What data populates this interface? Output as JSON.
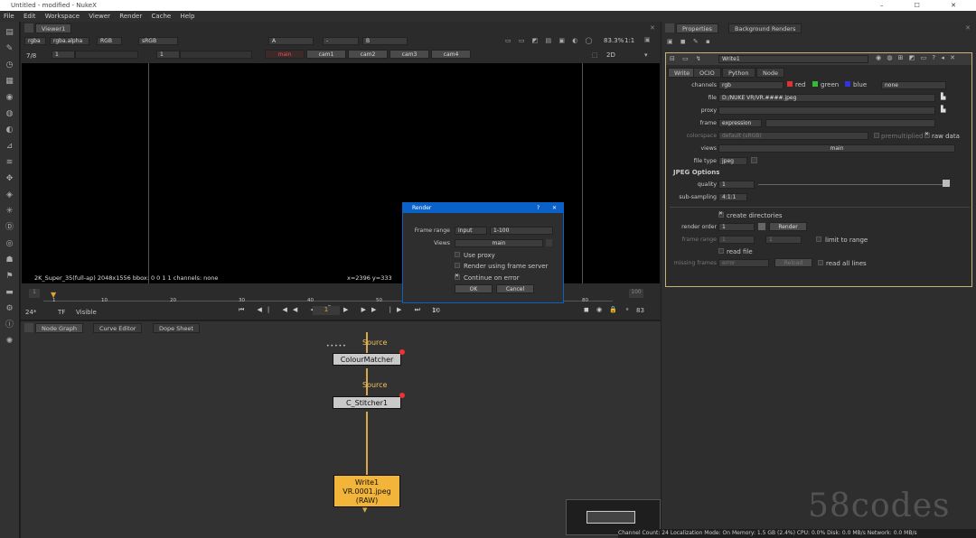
{
  "window": {
    "title": "Untitled - modified - NukeX",
    "controls": "– ☐ ✕"
  },
  "menu": [
    "File",
    "Edit",
    "Workspace",
    "Viewer",
    "Render",
    "Cache",
    "Help"
  ],
  "viewer": {
    "tab": "Viewer1",
    "channels": "rgba",
    "alpha": "rgba.alpha",
    "colorspace": "RGB",
    "lut": "sRGB",
    "input_a": "A",
    "input_b": "B",
    "zoom": "83.3%",
    "ratio": "1:1",
    "frame_fraction": "7/8",
    "frame_start": "1",
    "frame_num": "1",
    "view_mode": "2D",
    "view_buttons": [
      "main",
      "cam1",
      "cam2",
      "cam3",
      "cam4"
    ],
    "info_left": "2K_Super_35(full-ap) 2048x1556  bbox: 0 0 1 1 channels: none",
    "info_right": "x=2396 y=333"
  },
  "timeline": {
    "fps": "24*",
    "tf": "TF",
    "visible": "Visible",
    "current_frame": "1",
    "step": "10",
    "end_frame": "83",
    "ticks": [
      "1",
      "10",
      "20",
      "30",
      "40",
      "50",
      "60",
      "70",
      "80"
    ],
    "range_start": "1",
    "range_end": "100"
  },
  "graph_tabs": [
    "Node Graph",
    "Curve Editor",
    "Dope Sheet"
  ],
  "nodes": {
    "colour_matcher": "ColourMatcher",
    "stitcher": "C_Stitcher1",
    "source1": "Source",
    "source2": "Source",
    "write_line1": "Write1",
    "write_line2": "VR.0001.jpeg",
    "write_line3": "(RAW)"
  },
  "status_bar": "Channel Count: 24  Localization Mode: On  Memory: 1.5 GB (2.4%)  CPU: 0.0%  Disk: 0.0 MB/s  Network: 0.0 MB/s",
  "properties": {
    "tabs": [
      "Properties",
      "Background Renders"
    ],
    "node_name": "Write1",
    "subtabs": [
      "Write",
      "OCIO",
      "Python",
      "Node"
    ],
    "channels_label": "channels",
    "channels_value": "rgb",
    "chan_red": "red",
    "chan_green": "green",
    "chan_blue": "blue",
    "chan_none": "none",
    "file_label": "file",
    "file_value": "D:/NUKE VR/VR.####.jpeg",
    "proxy_label": "proxy",
    "frame_label": "frame",
    "frame_value": "expression",
    "colorspace_label": "colorspace",
    "colorspace_value": "default (sRGB)",
    "premultiplied": "premultiplied",
    "raw_data": "raw data",
    "views_label": "views",
    "views_value": "main",
    "filetype_label": "file type",
    "filetype_value": "jpeg",
    "jpeg_header": "JPEG Options",
    "quality_label": "quality",
    "quality_value": "1",
    "subsampling_label": "sub-sampling",
    "subsampling_value": "4:1:1",
    "create_dirs": "create directories",
    "render_order_label": "render order",
    "render_order_value": "1",
    "render_button": "Render",
    "frame_range_label": "frame range",
    "frame_range_a": "1",
    "frame_range_b": "1",
    "limit_to_range": "limit to range",
    "read_file": "read file",
    "missing_frames_label": "missing frames",
    "missing_frames_value": "error",
    "reload_button": "Reload",
    "read_all_lines": "read all lines"
  },
  "dialog": {
    "title": "Render",
    "frame_range_label": "Frame range",
    "frame_range_mode": "input",
    "frame_range_value": "1-100",
    "views_label": "Views",
    "views_value": "main",
    "use_proxy": "Use proxy",
    "frame_server": "Render using frame server",
    "continue_on_error": "Continue on error",
    "ok": "OK",
    "cancel": "Cancel"
  },
  "watermark": "58codes",
  "colors": {
    "accent": "#d7a84a",
    "node_write": "#f2b53a",
    "dialog_blue": "#0a62c9",
    "selection": "#c6b37a"
  }
}
